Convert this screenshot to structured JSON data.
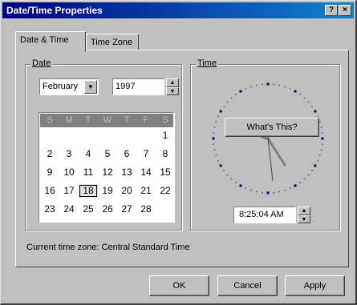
{
  "window": {
    "title": "Date/Time Properties",
    "help_button": "?",
    "close_button": "×"
  },
  "tabs": [
    {
      "label": "Date & Time",
      "active": true
    },
    {
      "label": "Time Zone",
      "active": false
    }
  ],
  "date_group": {
    "label": "Date",
    "month": "February",
    "year": "1997",
    "day_headers": [
      "S",
      "M",
      "T",
      "W",
      "T",
      "F",
      "S"
    ],
    "weeks": [
      [
        "",
        "",
        "",
        "",
        "",
        "",
        "1"
      ],
      [
        "2",
        "3",
        "4",
        "5",
        "6",
        "7",
        "8"
      ],
      [
        "9",
        "10",
        "11",
        "12",
        "13",
        "14",
        "15"
      ],
      [
        "16",
        "17",
        "18",
        "19",
        "20",
        "21",
        "22"
      ],
      [
        "23",
        "24",
        "25",
        "26",
        "27",
        "28",
        ""
      ]
    ],
    "selected_day": "18"
  },
  "time_group": {
    "label": "Time",
    "tooltip": "What's This?",
    "time_value": "8:25:04 AM"
  },
  "current_time_zone": "Current time zone:  Central Standard Time",
  "buttons": {
    "ok": "OK",
    "cancel": "Cancel",
    "apply": "Apply"
  },
  "colors": {
    "titlebar": "#000080",
    "face": "#c0c0c0",
    "calendar_header": "#808080"
  }
}
